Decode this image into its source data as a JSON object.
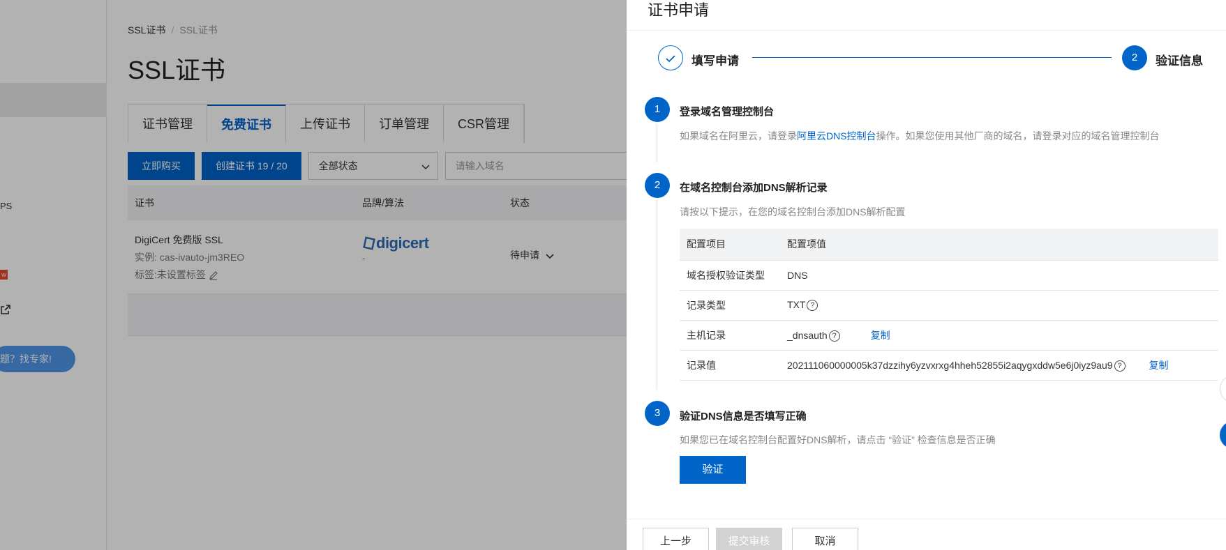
{
  "bg": {
    "nav_frag_ps": "PS",
    "nav_badge": "w",
    "expert_button": "题？找专家!",
    "collapse_glyph": "‹",
    "breadcrumb": [
      "SSL证书",
      "SSL证书"
    ],
    "page_title": "SSL证书",
    "tabs": [
      "证书管理",
      "免费证书",
      "上传证书",
      "订单管理",
      "CSR管理"
    ],
    "toolbar": {
      "buy": "立即购买",
      "create": "创建证书 19 / 20",
      "status_select": "全部状态",
      "search_placeholder": "请输入域名"
    },
    "table": {
      "headers": [
        "证书",
        "品牌/算法",
        "状态"
      ],
      "row": {
        "name": "DigiCert 免费版 SSL",
        "instance": "实例: cas-ivauto-jm3REO",
        "tag": "标签:未设置标签",
        "brand": "digicert",
        "brand_sub": "-",
        "status": "待申请"
      }
    }
  },
  "drawer": {
    "title": "证书申请",
    "steps": [
      {
        "label": "填写申请",
        "state": "done"
      },
      {
        "num": "2",
        "label": "验证信息",
        "state": "active"
      }
    ],
    "sections": [
      {
        "num": "1",
        "title": "登录域名管理控制台",
        "desc_pre": "如果域名在阿里云，请登录",
        "desc_link": "阿里云DNS控制台",
        "desc_post": "操作。如果您使用其他厂商的域名，请登录对应的域名管理控制台"
      },
      {
        "num": "2",
        "title": "在域名控制台添加DNS解析记录",
        "desc": "请按以下提示，在您的域名控制台添加DNS解析配置"
      },
      {
        "num": "3",
        "title": "验证DNS信息是否填写正确",
        "desc": "如果您已在域名控制台配置好DNS解析，请点击 “验证” 检查信息是否正确"
      }
    ],
    "dns_table": {
      "headers": [
        "配置项目",
        "配置项值"
      ],
      "rows": [
        {
          "item": "域名授权验证类型",
          "value": "DNS"
        },
        {
          "item": "记录类型",
          "value": "TXT"
        },
        {
          "item": "主机记录",
          "value": "_dnsauth",
          "copy": "复制"
        },
        {
          "item": "记录值",
          "value": "202111060000005k37dzzihy6yzvxrxg4hheh52855i2aqygxddw5e6j0iyz9au9",
          "copy": "复制"
        }
      ]
    },
    "help_glyph": "?",
    "verify_button": "验证",
    "footer": {
      "prev": "上一步",
      "submit": "提交审核",
      "cancel": "取消"
    }
  },
  "colors": {
    "primary": "#0064c8",
    "mask": "rgba(0,0,0,0.3)"
  }
}
